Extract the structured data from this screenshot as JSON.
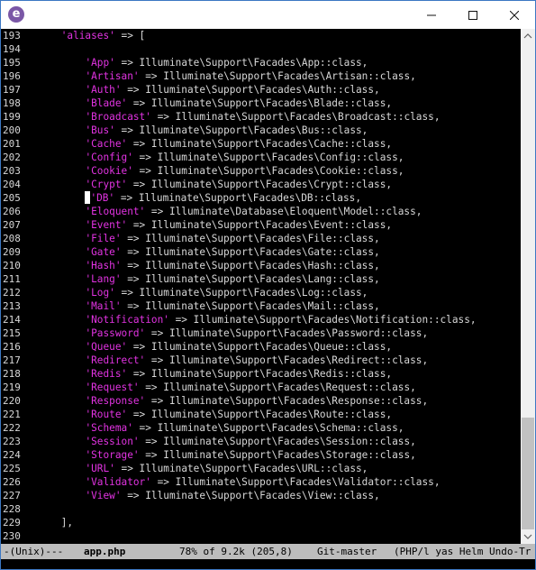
{
  "window": {
    "icon_letter": "e",
    "icon_color": "#7a57a6"
  },
  "editor": {
    "string_color": "#e233e2",
    "lines": [
      {
        "n": "193",
        "tokens": [
          {
            "t": "    "
          },
          {
            "t": "'aliases'",
            "c": "str"
          },
          {
            "t": " => ["
          }
        ]
      },
      {
        "n": "194",
        "tokens": []
      },
      {
        "n": "195",
        "tokens": [
          {
            "t": "        "
          },
          {
            "t": "'App'",
            "c": "str"
          },
          {
            "t": " => Illuminate\\Support\\Facades\\App::class,"
          }
        ]
      },
      {
        "n": "196",
        "tokens": [
          {
            "t": "        "
          },
          {
            "t": "'Artisan'",
            "c": "str"
          },
          {
            "t": " => Illuminate\\Support\\Facades\\Artisan::class,"
          }
        ]
      },
      {
        "n": "197",
        "tokens": [
          {
            "t": "        "
          },
          {
            "t": "'Auth'",
            "c": "str"
          },
          {
            "t": " => Illuminate\\Support\\Facades\\Auth::class,"
          }
        ]
      },
      {
        "n": "198",
        "tokens": [
          {
            "t": "        "
          },
          {
            "t": "'Blade'",
            "c": "str"
          },
          {
            "t": " => Illuminate\\Support\\Facades\\Blade::class,"
          }
        ]
      },
      {
        "n": "199",
        "tokens": [
          {
            "t": "        "
          },
          {
            "t": "'Broadcast'",
            "c": "str"
          },
          {
            "t": " => Illuminate\\Support\\Facades\\Broadcast::class,"
          }
        ]
      },
      {
        "n": "200",
        "tokens": [
          {
            "t": "        "
          },
          {
            "t": "'Bus'",
            "c": "str"
          },
          {
            "t": " => Illuminate\\Support\\Facades\\Bus::class,"
          }
        ]
      },
      {
        "n": "201",
        "tokens": [
          {
            "t": "        "
          },
          {
            "t": "'Cache'",
            "c": "str"
          },
          {
            "t": " => Illuminate\\Support\\Facades\\Cache::class,"
          }
        ]
      },
      {
        "n": "202",
        "tokens": [
          {
            "t": "        "
          },
          {
            "t": "'Config'",
            "c": "str"
          },
          {
            "t": " => Illuminate\\Support\\Facades\\Config::class,"
          }
        ]
      },
      {
        "n": "203",
        "tokens": [
          {
            "t": "        "
          },
          {
            "t": "'Cookie'",
            "c": "str"
          },
          {
            "t": " => Illuminate\\Support\\Facades\\Cookie::class,"
          }
        ]
      },
      {
        "n": "204",
        "tokens": [
          {
            "t": "        "
          },
          {
            "t": "'Crypt'",
            "c": "str"
          },
          {
            "t": " => Illuminate\\Support\\Facades\\Crypt::class,"
          }
        ]
      },
      {
        "n": "205",
        "tokens": [
          {
            "t": "        "
          },
          {
            "t": "",
            "c": "cursor"
          },
          {
            "t": "'DB'",
            "c": "str"
          },
          {
            "t": " => Illuminate\\Support\\Facades\\DB::class,"
          }
        ]
      },
      {
        "n": "206",
        "tokens": [
          {
            "t": "        "
          },
          {
            "t": "'Eloquent'",
            "c": "str"
          },
          {
            "t": " => Illuminate\\Database\\Eloquent\\Model::class,"
          }
        ]
      },
      {
        "n": "207",
        "tokens": [
          {
            "t": "        "
          },
          {
            "t": "'Event'",
            "c": "str"
          },
          {
            "t": " => Illuminate\\Support\\Facades\\Event::class,"
          }
        ]
      },
      {
        "n": "208",
        "tokens": [
          {
            "t": "        "
          },
          {
            "t": "'File'",
            "c": "str"
          },
          {
            "t": " => Illuminate\\Support\\Facades\\File::class,"
          }
        ]
      },
      {
        "n": "209",
        "tokens": [
          {
            "t": "        "
          },
          {
            "t": "'Gate'",
            "c": "str"
          },
          {
            "t": " => Illuminate\\Support\\Facades\\Gate::class,"
          }
        ]
      },
      {
        "n": "210",
        "tokens": [
          {
            "t": "        "
          },
          {
            "t": "'Hash'",
            "c": "str"
          },
          {
            "t": " => Illuminate\\Support\\Facades\\Hash::class,"
          }
        ]
      },
      {
        "n": "211",
        "tokens": [
          {
            "t": "        "
          },
          {
            "t": "'Lang'",
            "c": "str"
          },
          {
            "t": " => Illuminate\\Support\\Facades\\Lang::class,"
          }
        ]
      },
      {
        "n": "212",
        "tokens": [
          {
            "t": "        "
          },
          {
            "t": "'Log'",
            "c": "str"
          },
          {
            "t": " => Illuminate\\Support\\Facades\\Log::class,"
          }
        ]
      },
      {
        "n": "213",
        "tokens": [
          {
            "t": "        "
          },
          {
            "t": "'Mail'",
            "c": "str"
          },
          {
            "t": " => Illuminate\\Support\\Facades\\Mail::class,"
          }
        ]
      },
      {
        "n": "214",
        "tokens": [
          {
            "t": "        "
          },
          {
            "t": "'Notification'",
            "c": "str"
          },
          {
            "t": " => Illuminate\\Support\\Facades\\Notification::class,"
          }
        ]
      },
      {
        "n": "215",
        "tokens": [
          {
            "t": "        "
          },
          {
            "t": "'Password'",
            "c": "str"
          },
          {
            "t": " => Illuminate\\Support\\Facades\\Password::class,"
          }
        ]
      },
      {
        "n": "216",
        "tokens": [
          {
            "t": "        "
          },
          {
            "t": "'Queue'",
            "c": "str"
          },
          {
            "t": " => Illuminate\\Support\\Facades\\Queue::class,"
          }
        ]
      },
      {
        "n": "217",
        "tokens": [
          {
            "t": "        "
          },
          {
            "t": "'Redirect'",
            "c": "str"
          },
          {
            "t": " => Illuminate\\Support\\Facades\\Redirect::class,"
          }
        ]
      },
      {
        "n": "218",
        "tokens": [
          {
            "t": "        "
          },
          {
            "t": "'Redis'",
            "c": "str"
          },
          {
            "t": " => Illuminate\\Support\\Facades\\Redis::class,"
          }
        ]
      },
      {
        "n": "219",
        "tokens": [
          {
            "t": "        "
          },
          {
            "t": "'Request'",
            "c": "str"
          },
          {
            "t": " => Illuminate\\Support\\Facades\\Request::class,"
          }
        ]
      },
      {
        "n": "220",
        "tokens": [
          {
            "t": "        "
          },
          {
            "t": "'Response'",
            "c": "str"
          },
          {
            "t": " => Illuminate\\Support\\Facades\\Response::class,"
          }
        ]
      },
      {
        "n": "221",
        "tokens": [
          {
            "t": "        "
          },
          {
            "t": "'Route'",
            "c": "str"
          },
          {
            "t": " => Illuminate\\Support\\Facades\\Route::class,"
          }
        ]
      },
      {
        "n": "222",
        "tokens": [
          {
            "t": "        "
          },
          {
            "t": "'Schema'",
            "c": "str"
          },
          {
            "t": " => Illuminate\\Support\\Facades\\Schema::class,"
          }
        ]
      },
      {
        "n": "223",
        "tokens": [
          {
            "t": "        "
          },
          {
            "t": "'Session'",
            "c": "str"
          },
          {
            "t": " => Illuminate\\Support\\Facades\\Session::class,"
          }
        ]
      },
      {
        "n": "224",
        "tokens": [
          {
            "t": "        "
          },
          {
            "t": "'Storage'",
            "c": "str"
          },
          {
            "t": " => Illuminate\\Support\\Facades\\Storage::class,"
          }
        ]
      },
      {
        "n": "225",
        "tokens": [
          {
            "t": "        "
          },
          {
            "t": "'URL'",
            "c": "str"
          },
          {
            "t": " => Illuminate\\Support\\Facades\\URL::class,"
          }
        ]
      },
      {
        "n": "226",
        "tokens": [
          {
            "t": "        "
          },
          {
            "t": "'Validator'",
            "c": "str"
          },
          {
            "t": " => Illuminate\\Support\\Facades\\Validator::class,"
          }
        ]
      },
      {
        "n": "227",
        "tokens": [
          {
            "t": "        "
          },
          {
            "t": "'View'",
            "c": "str"
          },
          {
            "t": " => Illuminate\\Support\\Facades\\View::class,"
          }
        ]
      },
      {
        "n": "228",
        "tokens": []
      },
      {
        "n": "229",
        "tokens": [
          {
            "t": "    ],"
          }
        ]
      },
      {
        "n": "230",
        "tokens": []
      }
    ]
  },
  "modeline": {
    "encoding": "-(Unix)---",
    "filename": "app.php",
    "position": "78% of 9.2k (205,8)",
    "vc": "Git-master",
    "modes": "(PHP/l yas Helm Undo-Tr"
  }
}
